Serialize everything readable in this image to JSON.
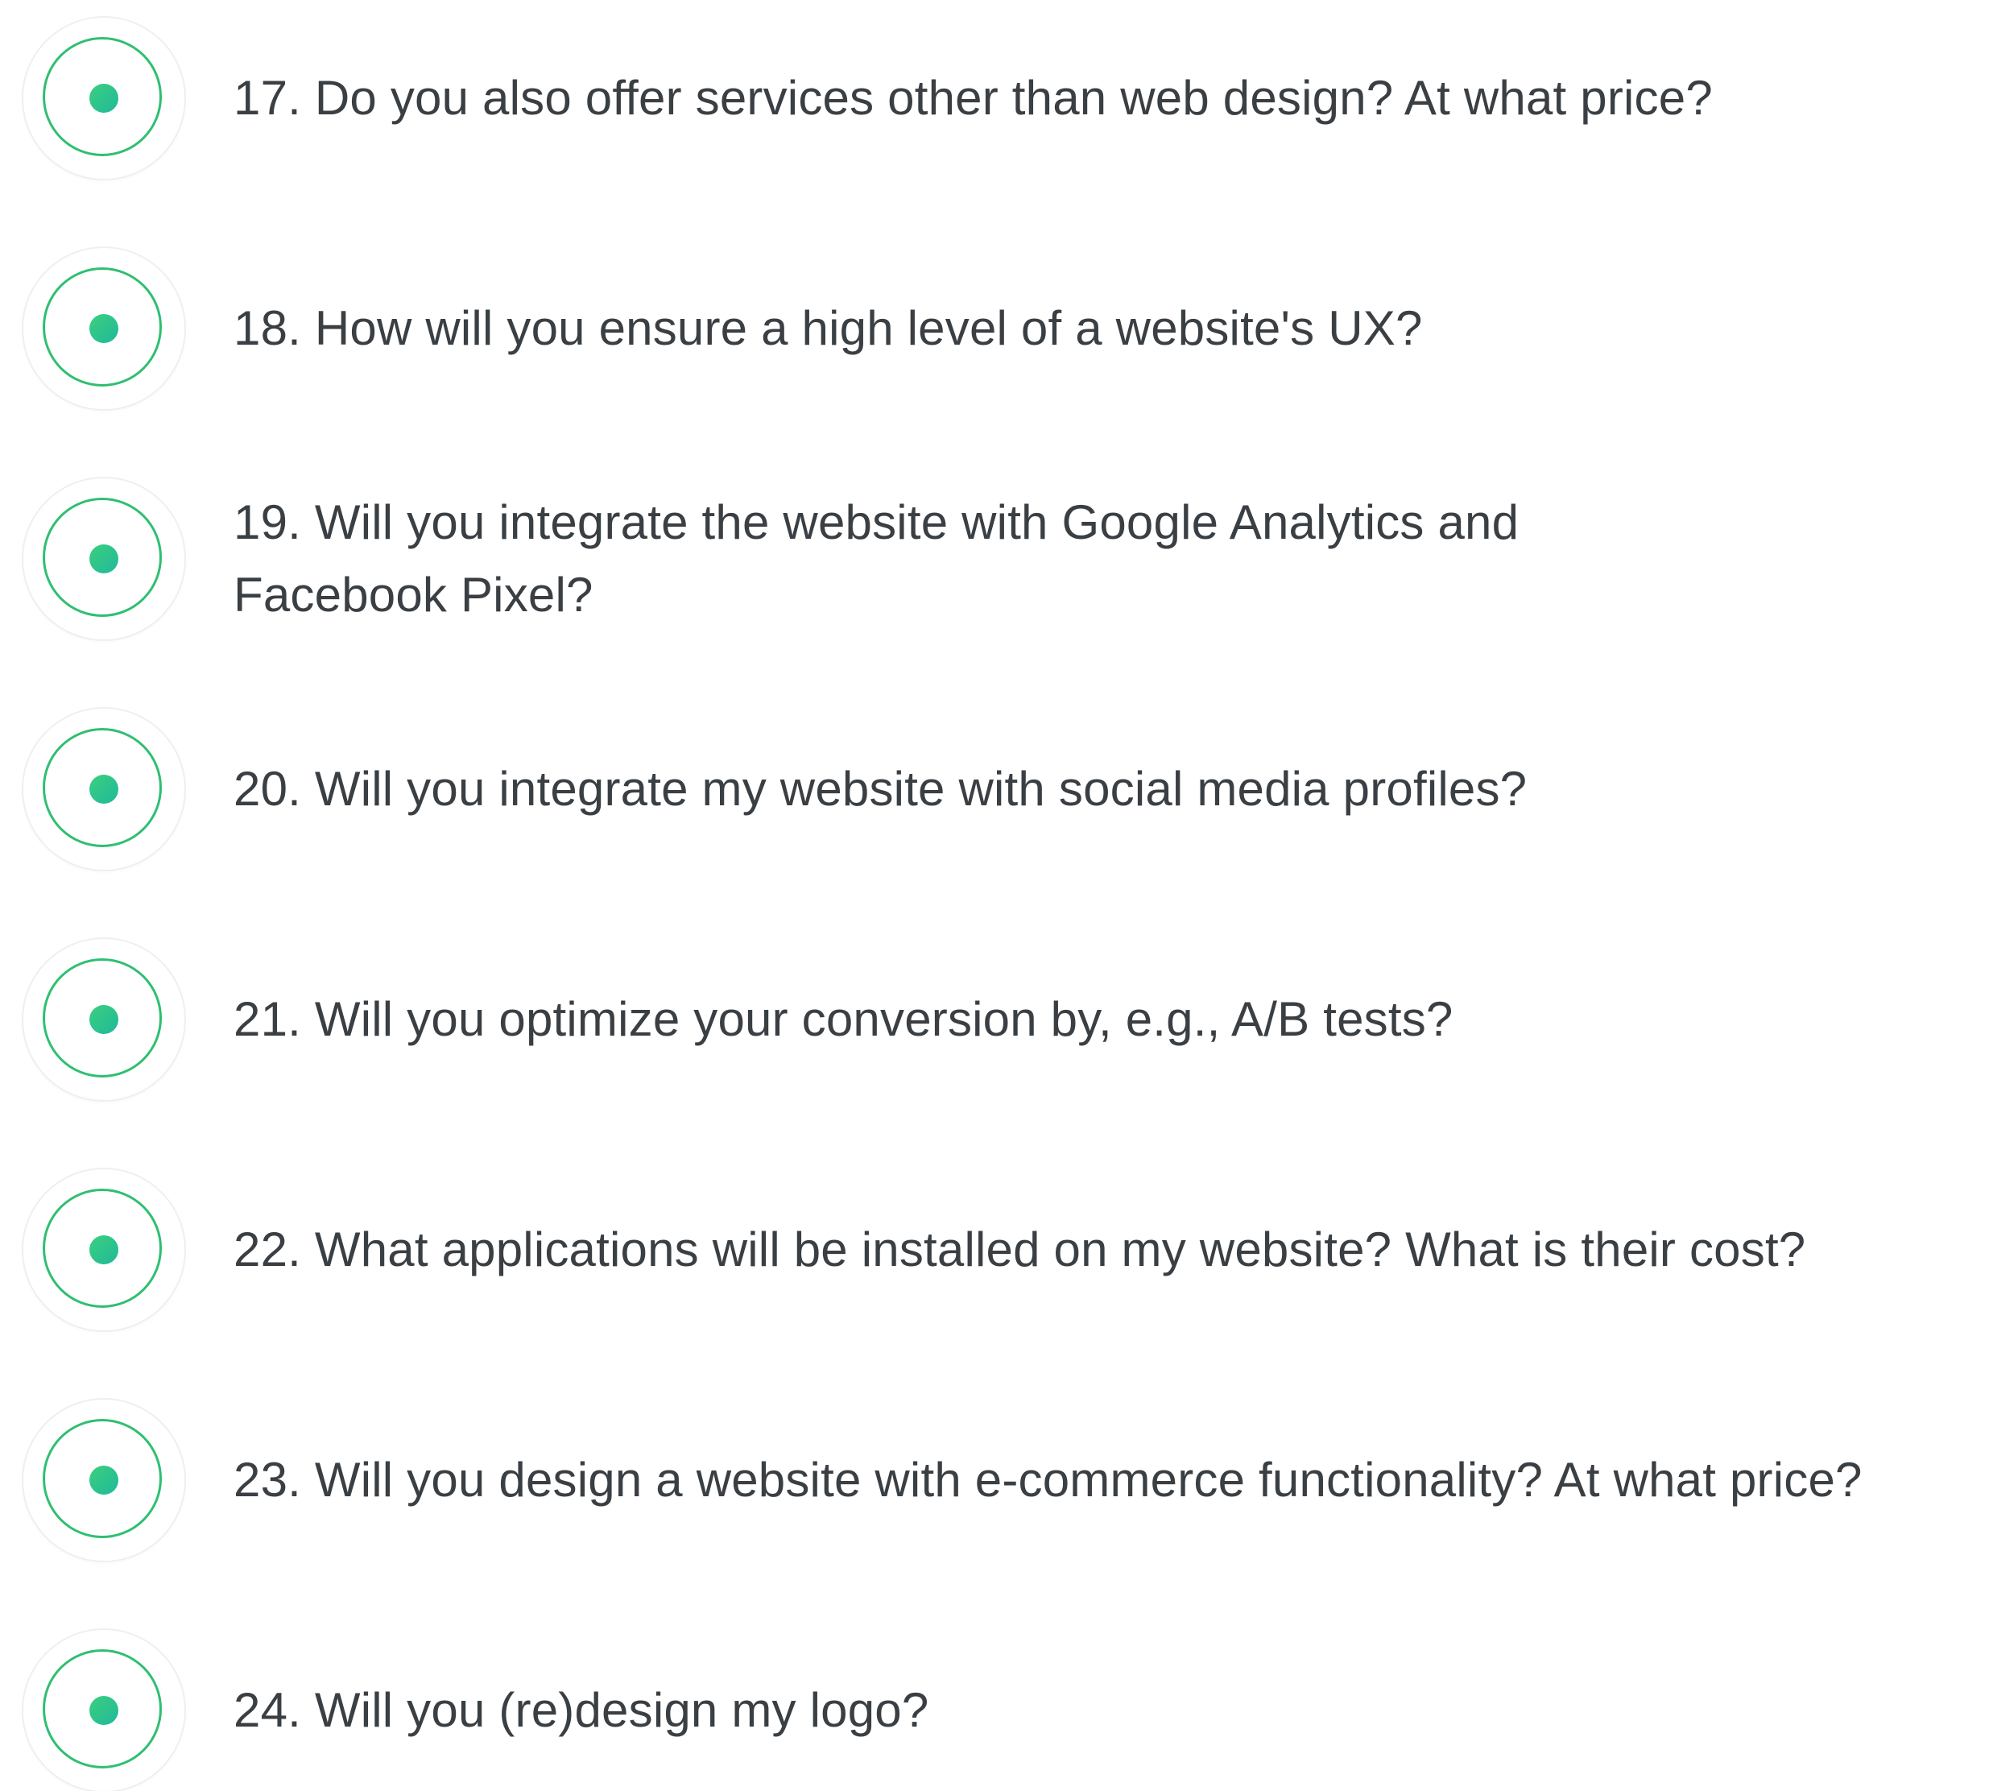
{
  "faq": {
    "items": [
      {
        "text": "17. Do you also offer services other than web design? At what price?"
      },
      {
        "text": "18. How will you ensure a high level of a website's UX?"
      },
      {
        "text": "19. Will you integrate the website with Google Analytics and\nFacebook Pixel?"
      },
      {
        "text": "20. Will you integrate my website with social media profiles?"
      },
      {
        "text": "21. Will you optimize your conversion by, e.g.,  A/B tests?"
      },
      {
        "text": "22. What applications will be installed on my website? What is their cost?"
      },
      {
        "text": "23. Will you design a website with e-commerce functionality? At what price?"
      },
      {
        "text": "24. Will you (re)design my logo?"
      }
    ]
  },
  "colors": {
    "ring": "#2fbf71",
    "dot_start": "#3ccf7e",
    "dot_end": "#20b99a",
    "text": "#3a3f44"
  },
  "icons": {
    "marker": "radio-dot-icon"
  }
}
